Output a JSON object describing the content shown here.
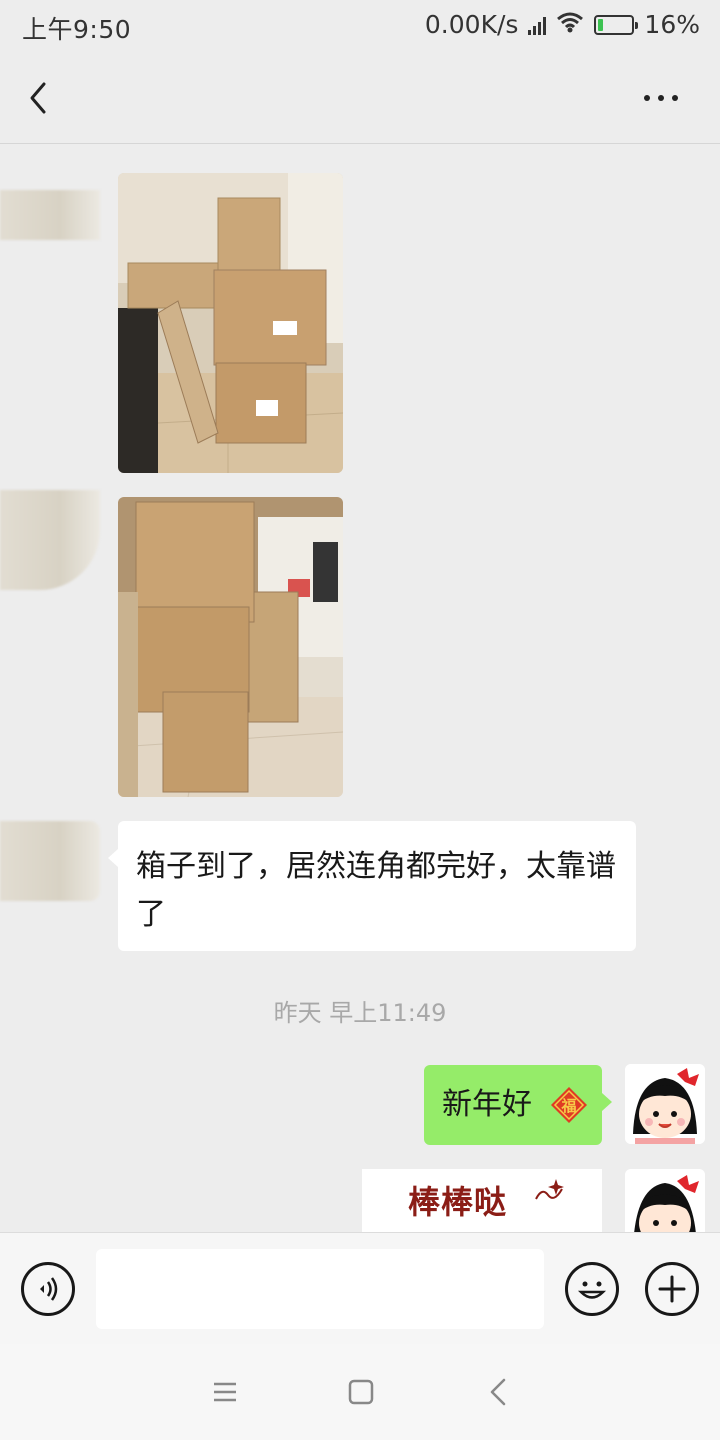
{
  "status_bar": {
    "time": "上午9:50",
    "net_speed": "0.00K/s",
    "battery_percent": "16%",
    "battery_level": 0.16,
    "battery_color": "#3cc251"
  },
  "header": {
    "back_icon": "chevron-left-icon",
    "more_icon": "more-horizontal-icon"
  },
  "messages": [
    {
      "from": "other",
      "kind": "image",
      "content": "photo of stacked cardboard boxes in a kitchen"
    },
    {
      "from": "other",
      "kind": "image",
      "content": "photo of cardboard boxes stacked in a living room"
    },
    {
      "from": "other",
      "kind": "text",
      "text": "箱子到了，居然连角都完好，太靠谱了"
    },
    {
      "kind": "timestamp",
      "text": "昨天 早上11:49"
    },
    {
      "from": "self",
      "kind": "text",
      "text": "新年好",
      "emoji_icon": "fu-icon"
    },
    {
      "from": "self",
      "kind": "sticker",
      "text": "棒棒哒"
    }
  ],
  "input_bar": {
    "voice_icon": "voice-icon",
    "emoji_icon": "smiley-icon",
    "more_icon": "plus-icon",
    "value": ""
  },
  "nav_bar": {
    "menu_icon": "menu-icon",
    "home_icon": "home-icon",
    "back_icon": "back-icon"
  },
  "colors": {
    "background": "#ededed",
    "self_bubble": "#95ec69",
    "other_bubble": "#ffffff",
    "timestamp_text": "#a8a8a8"
  }
}
